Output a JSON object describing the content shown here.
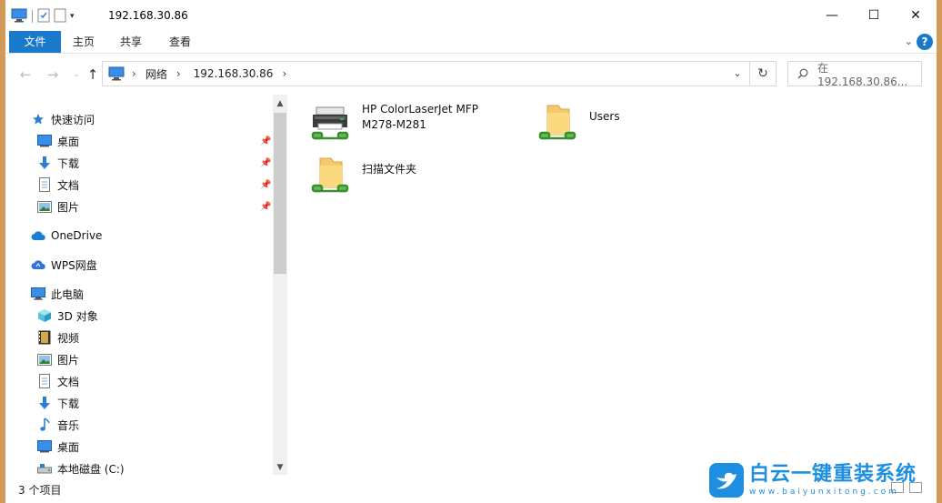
{
  "window": {
    "title": "192.168.30.86",
    "minimize_glyph": "—",
    "maximize_glyph": "☐",
    "close_glyph": "✕"
  },
  "ribbon": {
    "tabs": [
      {
        "label": "文件",
        "active": true
      },
      {
        "label": "主页"
      },
      {
        "label": "共享"
      },
      {
        "label": "查看"
      }
    ]
  },
  "address": {
    "crumbs": [
      "网络",
      "192.168.30.86"
    ],
    "search_placeholder": "在 192.168.30.86..."
  },
  "nav": {
    "quick_access": "快速访问",
    "quick_items": [
      {
        "label": "桌面",
        "icon": "desktop-icon"
      },
      {
        "label": "下载",
        "icon": "download-icon"
      },
      {
        "label": "文档",
        "icon": "document-icon"
      },
      {
        "label": "图片",
        "icon": "picture-icon"
      }
    ],
    "onedrive": "OneDrive",
    "wps": "WPS网盘",
    "this_pc": "此电脑",
    "pc_items": [
      {
        "label": "3D 对象",
        "icon": "3d-objects-icon"
      },
      {
        "label": "视频",
        "icon": "video-icon"
      },
      {
        "label": "图片",
        "icon": "picture-icon"
      },
      {
        "label": "文档",
        "icon": "document-icon"
      },
      {
        "label": "下载",
        "icon": "download-icon"
      },
      {
        "label": "音乐",
        "icon": "music-icon"
      },
      {
        "label": "桌面",
        "icon": "desktop-icon"
      },
      {
        "label": "本地磁盘 (C:)",
        "icon": "local-disk-icon"
      }
    ]
  },
  "content": {
    "items": [
      {
        "label_line1": "HP ColorLaserJet MFP",
        "label_line2": "M278-M281",
        "icon": "network-printer-icon"
      },
      {
        "label_line1": "Users",
        "label_line2": "",
        "icon": "shared-folder-icon"
      },
      {
        "label_line1": "扫描文件夹",
        "label_line2": "",
        "icon": "shared-folder-icon"
      }
    ]
  },
  "status": {
    "item_count": "3 个项目"
  },
  "watermark": {
    "title": "白云一键重装系统",
    "url": "www.baiyunxitong.com"
  },
  "colors": {
    "accent": "#1979ca",
    "watermark": "#1e8fe0",
    "folder": "#f5c96b",
    "network": "#52b043"
  }
}
